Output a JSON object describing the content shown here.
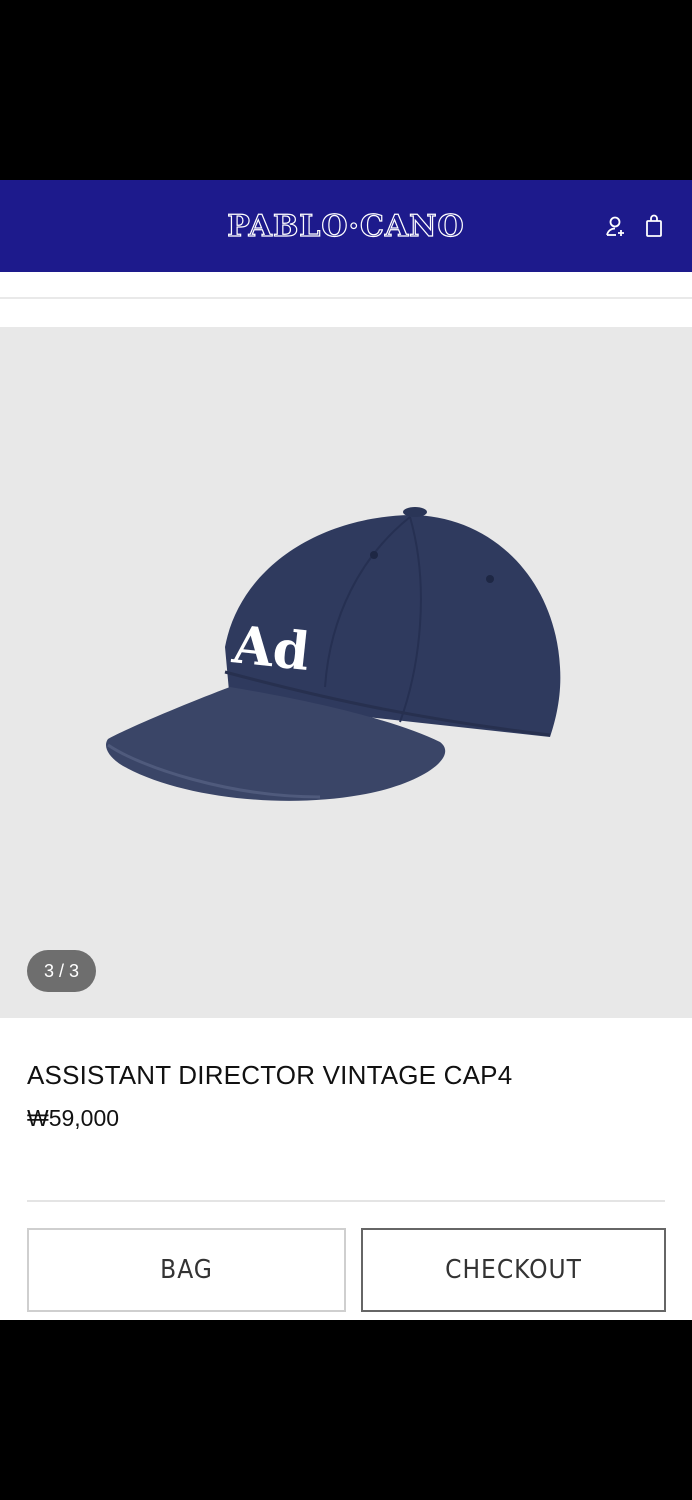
{
  "header": {
    "logo": "PABLO·CANO",
    "icons": [
      "user-icon",
      "bag-icon"
    ],
    "background": "#1d1a8c"
  },
  "gallery": {
    "counter": "3 / 3",
    "cap_text": "Ad",
    "background": "#e8e8e8"
  },
  "product": {
    "title": "ASSISTANT DIRECTOR VINTAGE CAP4",
    "price": "₩59,000"
  },
  "actions": {
    "bag_label": "BAG",
    "checkout_label": "CHECKOUT"
  }
}
